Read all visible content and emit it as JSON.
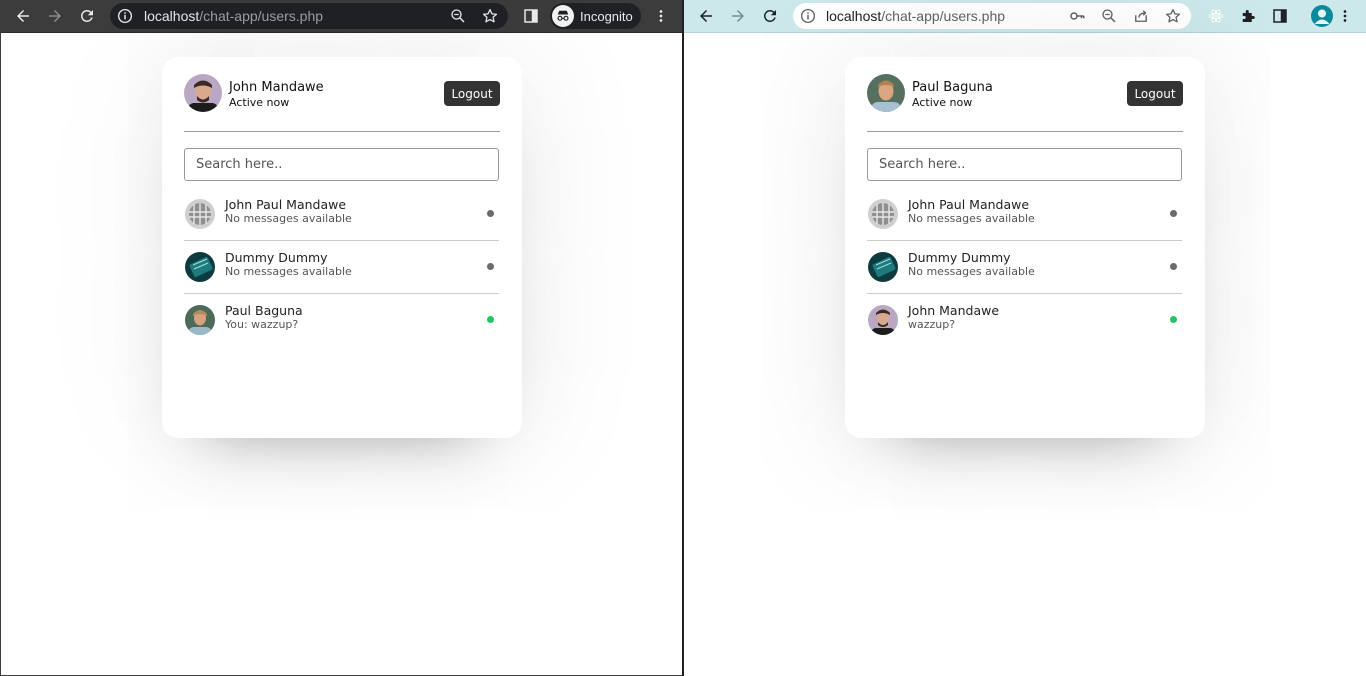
{
  "colors": {
    "offline": "#6b6b6b",
    "online": "#22c55e",
    "logout_bg": "#333333"
  },
  "left_window": {
    "url_host": "localhost",
    "url_path": "/chat-app/users.php",
    "incognito_label": "Incognito",
    "current_user": {
      "name": "John Mandawe",
      "status": "Active now"
    },
    "logout_label": "Logout",
    "search_placeholder": "Search here..",
    "users": [
      {
        "name": "John Paul Mandawe",
        "message": "No messages available",
        "status": "offline"
      },
      {
        "name": "Dummy Dummy",
        "message": "No messages available",
        "status": "offline"
      },
      {
        "name": "Paul Baguna",
        "message": "You: wazzup?",
        "status": "online"
      }
    ]
  },
  "right_window": {
    "url_host": "localhost",
    "url_path": "/chat-app/users.php",
    "current_user": {
      "name": "Paul Baguna",
      "status": "Active now"
    },
    "logout_label": "Logout",
    "search_placeholder": "Search here..",
    "users": [
      {
        "name": "John Paul Mandawe",
        "message": "No messages available",
        "status": "offline"
      },
      {
        "name": "Dummy Dummy",
        "message": "No messages available",
        "status": "offline"
      },
      {
        "name": "John Mandawe",
        "message": "wazzup?",
        "status": "online"
      }
    ]
  }
}
